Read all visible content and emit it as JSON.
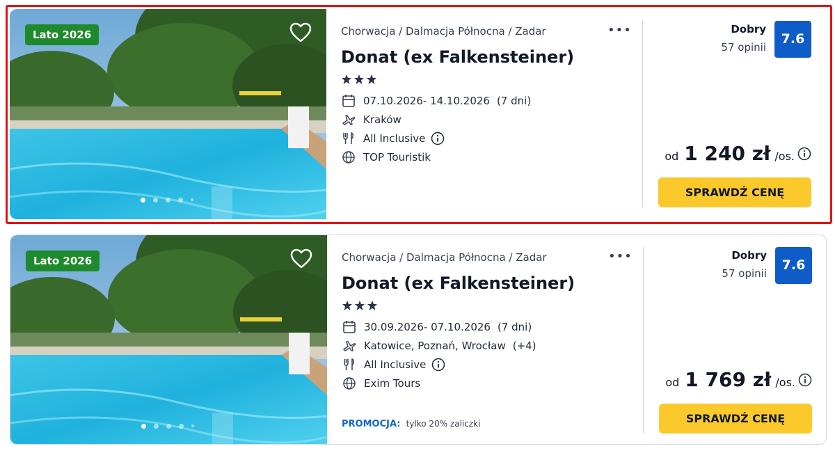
{
  "offers": [
    {
      "season_badge": "Lato 2026",
      "breadcrumb": "Chorwacja / Dalmacja Północna / Zadar",
      "more_label": "•••",
      "hotel_name": "Donat (ex Falkensteiner)",
      "stars": 3,
      "dates": "07.10.2026- 14.10.2026",
      "duration": "(7 dni)",
      "departure": "Kraków",
      "departure_extra": "",
      "board": "All Inclusive",
      "operator": "TOP Touristik",
      "promo_label": "",
      "promo_text": "",
      "rating_word": "Dobry",
      "rating_count": "57 opinii",
      "rating_score": "7.6",
      "price_prefix": "od",
      "price_value": "1 240 zł",
      "price_unit": "/os.",
      "cta_label": "SPRAWDŹ CENĘ",
      "photo_dots": 5,
      "active_photo_index": 0,
      "highlighted": true
    },
    {
      "season_badge": "Lato 2026",
      "breadcrumb": "Chorwacja / Dalmacja Północna / Zadar",
      "more_label": "•••",
      "hotel_name": "Donat (ex Falkensteiner)",
      "stars": 3,
      "dates": "30.09.2026- 07.10.2026",
      "duration": "(7 dni)",
      "departure": "Katowice, Poznań, Wrocław",
      "departure_extra": "(+4)",
      "board": "All Inclusive",
      "operator": "Exim Tours",
      "promo_label": "PROMOCJA:",
      "promo_text": "tylko 20% zaliczki",
      "rating_word": "Dobry",
      "rating_count": "57 opinii",
      "rating_score": "7.6",
      "price_prefix": "od",
      "price_value": "1 769 zł",
      "price_unit": "/os.",
      "cta_label": "SPRAWDŹ CENĘ",
      "photo_dots": 5,
      "active_photo_index": 0,
      "highlighted": false
    }
  ],
  "icons": {
    "favorite": "heart-outline-icon",
    "more": "more-dots-icon",
    "star": "star-icon",
    "dates": "calendar-icon",
    "departure": "airplane-icon",
    "board": "cutlery-icon",
    "operator": "globe-icon",
    "info": "info-circle-icon"
  },
  "colors": {
    "season_badge": "#1f8a2c",
    "rating_box": "#0d5cc7",
    "cta": "#fcc92c",
    "promo_label": "#1467c4",
    "highlight_border": "#e11414"
  }
}
